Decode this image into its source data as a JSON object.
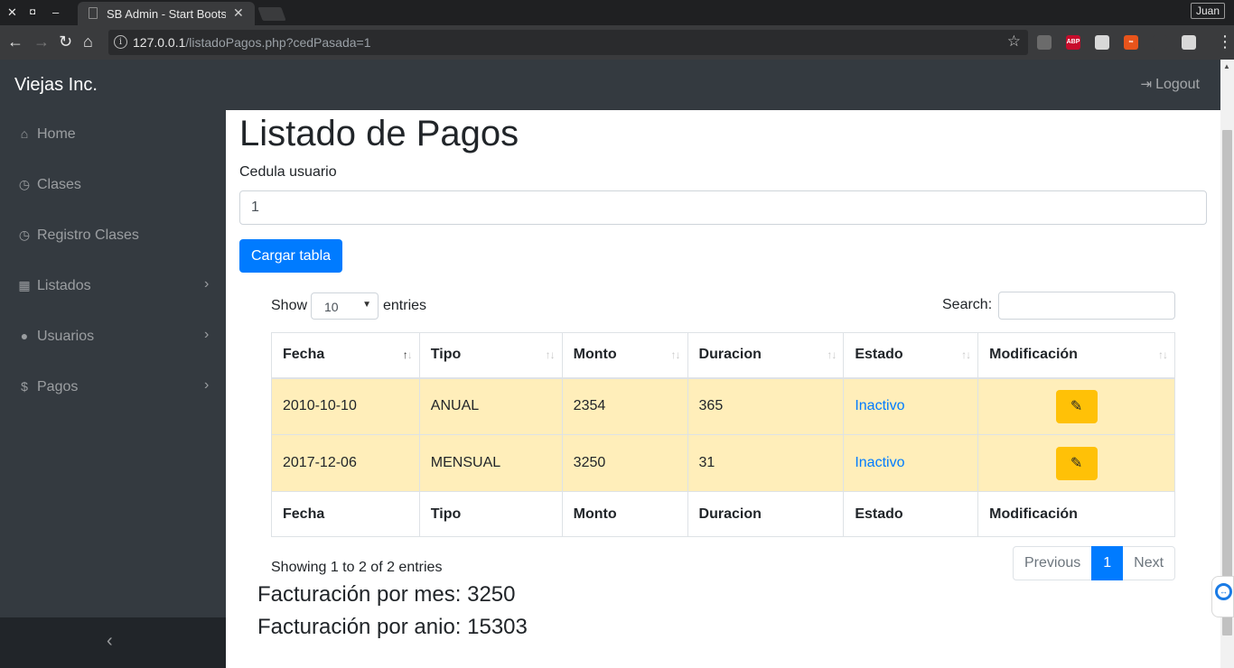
{
  "browser": {
    "window_controls": [
      "✕",
      "◘",
      "‒"
    ],
    "tab_title": "SB Admin - Start Bootstrap",
    "tab_close": "✕",
    "user": "Juan",
    "url_host": "127.0.0.1",
    "url_path": "/listadoPagos.php?cedPasada=1",
    "extensions": [
      {
        "name": "lightbulb-extension-icon",
        "color": "#6b6b6b",
        "text": ""
      },
      {
        "name": "adblock-plus-icon",
        "color": "#c70d2c",
        "text": "ABP"
      },
      {
        "name": "youtube-extension-icon",
        "color": "#d8d8d8",
        "text": ""
      },
      {
        "name": "infinity-extension-icon",
        "color": "#e8541b",
        "text": "∞"
      },
      {
        "name": "gnome-extension-icon",
        "color": "#3a3b3d",
        "text": ""
      },
      {
        "name": "cube-extension-icon",
        "color": "#d8d8d8",
        "text": ""
      }
    ]
  },
  "navbar": {
    "brand": "Viejas Inc.",
    "logout": "Logout"
  },
  "sidebar": {
    "items": [
      {
        "label": "Home",
        "icon": "home-icon",
        "glyph": "⌂",
        "chevron": false
      },
      {
        "label": "Clases",
        "icon": "clock-icon",
        "glyph": "◷",
        "chevron": false
      },
      {
        "label": "Registro Clases",
        "icon": "clock-icon",
        "glyph": "◷",
        "chevron": false
      },
      {
        "label": "Listados",
        "icon": "table-icon",
        "glyph": "▦",
        "chevron": true
      },
      {
        "label": "Usuarios",
        "icon": "user-icon",
        "glyph": "●",
        "chevron": true
      },
      {
        "label": "Pagos",
        "icon": "dollar-icon",
        "glyph": "$",
        "chevron": true
      }
    ],
    "toggler": "‹"
  },
  "main": {
    "title": "Listado de Pagos",
    "cedula_label": "Cedula usuario",
    "cedula_value": "1",
    "load_button": "Cargar tabla"
  },
  "datatable": {
    "show_label": "Show",
    "page_length": "10",
    "entries_label": "entries",
    "search_label": "Search:",
    "columns": [
      "Fecha",
      "Tipo",
      "Monto",
      "Duracion",
      "Estado",
      "Modificación"
    ],
    "sorted_column": 0,
    "rows": [
      {
        "fecha": "2010-10-10",
        "tipo": "ANUAL",
        "monto": "2354",
        "duracion": "365",
        "estado": "Inactivo"
      },
      {
        "fecha": "2017-12-06",
        "tipo": "MENSUAL",
        "monto": "3250",
        "duracion": "31",
        "estado": "Inactivo"
      }
    ],
    "info": "Showing 1 to 2 of 2 entries",
    "pagination": {
      "previous": "Previous",
      "current": "1",
      "next": "Next"
    }
  },
  "billing": {
    "per_month": "Facturación por mes: 3250",
    "per_year": "Facturación por anio: 15303"
  },
  "colors": {
    "primary": "#007bff",
    "warning": "#ffc107",
    "row_warning": "#ffeeba",
    "dark": "#343a40"
  }
}
